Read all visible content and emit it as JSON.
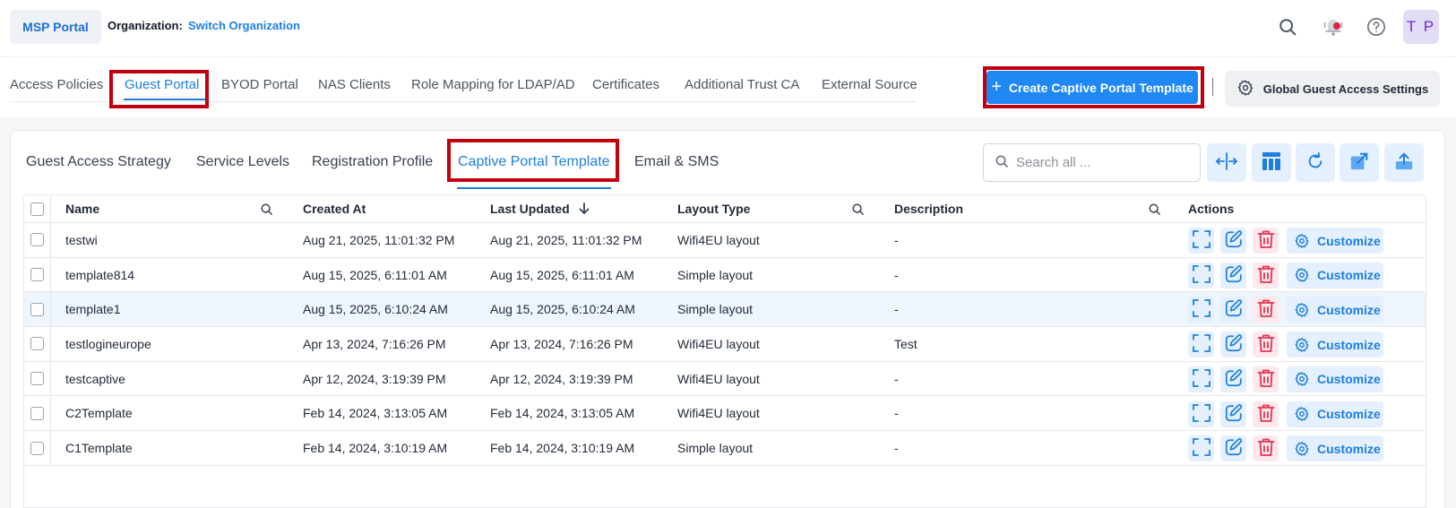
{
  "topbar": {
    "msp_label": "MSP Portal",
    "org_label": "Organization:",
    "org_link": "Switch Organization",
    "avatar_initials": "T P"
  },
  "mainnav": {
    "items": [
      "Access Policies",
      "Guest Portal",
      "BYOD Portal",
      "NAS Clients",
      "Role Mapping for LDAP/AD",
      "Certificates",
      "Additional Trust CA",
      "External Source"
    ],
    "active": "Guest Portal"
  },
  "actions": {
    "create_label": "Create Captive Portal Template",
    "global_label": "Global Guest Access Settings"
  },
  "subnav": {
    "items": [
      "Guest Access Strategy",
      "Service Levels",
      "Registration Profile",
      "Captive Portal Template",
      "Email & SMS"
    ],
    "active": "Captive Portal Template"
  },
  "search": {
    "placeholder": "Search all ..."
  },
  "table": {
    "columns": [
      "Name",
      "Created At",
      "Last Updated",
      "Layout Type",
      "Description",
      "Actions"
    ],
    "customize_label": "Customize",
    "rows": [
      {
        "name": "testwi",
        "created": "Aug 21, 2025, 11:01:32 PM",
        "updated": "Aug 21, 2025, 11:01:32 PM",
        "layout": "Wifi4EU layout",
        "description": "-"
      },
      {
        "name": "template814",
        "created": "Aug 15, 2025, 6:11:01 AM",
        "updated": "Aug 15, 2025, 6:11:01 AM",
        "layout": "Simple layout",
        "description": "-"
      },
      {
        "name": "template1",
        "created": "Aug 15, 2025, 6:10:24 AM",
        "updated": "Aug 15, 2025, 6:10:24 AM",
        "layout": "Simple layout",
        "description": "-"
      },
      {
        "name": "testlogineurope",
        "created": "Apr 13, 2024, 7:16:26 PM",
        "updated": "Apr 13, 2024, 7:16:26 PM",
        "layout": "Wifi4EU layout",
        "description": "Test"
      },
      {
        "name": "testcaptive",
        "created": "Apr 12, 2024, 3:19:39 PM",
        "updated": "Apr 12, 2024, 3:19:39 PM",
        "layout": "Wifi4EU layout",
        "description": "-"
      },
      {
        "name": "C2Template",
        "created": "Feb 14, 2024, 3:13:05 AM",
        "updated": "Feb 14, 2024, 3:13:05 AM",
        "layout": "Wifi4EU layout",
        "description": "-"
      },
      {
        "name": "C1Template",
        "created": "Feb 14, 2024, 3:10:19 AM",
        "updated": "Feb 14, 2024, 3:10:19 AM",
        "layout": "Simple layout",
        "description": "-"
      }
    ]
  },
  "colors": {
    "accent": "#1d7fe0",
    "primary_button": "#1f88f5",
    "highlight": "#c0000f",
    "danger": "#e5334f"
  }
}
